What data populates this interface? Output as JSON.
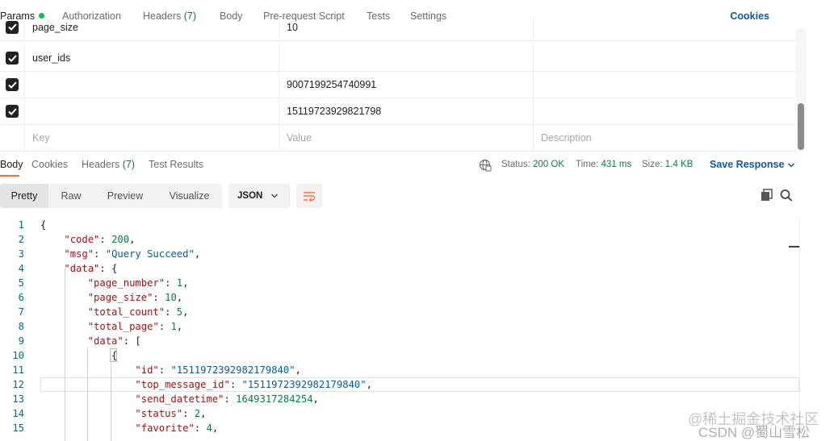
{
  "request_tabs": {
    "params": "Params",
    "authorization": "Authorization",
    "headers_label": "Headers",
    "headers_count": "(7)",
    "body": "Body",
    "pre_request": "Pre-request Script",
    "tests": "Tests",
    "settings": "Settings",
    "cookies": "Cookies"
  },
  "params": {
    "rows": [
      {
        "checked": true,
        "key": "page_size",
        "value": "10",
        "description": ""
      },
      {
        "checked": true,
        "key": "user_ids",
        "value": "",
        "description": ""
      },
      {
        "checked": true,
        "key": "",
        "value": "9007199254740991",
        "description": ""
      },
      {
        "checked": true,
        "key": "",
        "value": "15119723929821798",
        "description": ""
      }
    ],
    "placeholders": {
      "key": "Key",
      "value": "Value",
      "description": "Description"
    }
  },
  "response_tabs": {
    "body": "Body",
    "cookies": "Cookies",
    "headers_label": "Headers",
    "headers_count": "(7)",
    "test_results": "Test Results"
  },
  "status": {
    "status_label": "Status:",
    "status_value": "200 OK",
    "time_label": "Time:",
    "time_value": "431 ms",
    "size_label": "Size:",
    "size_value": "1.4 KB",
    "save_response": "Save Response"
  },
  "view_modes": {
    "pretty": "Pretty",
    "raw": "Raw",
    "preview": "Preview",
    "visualize": "Visualize",
    "format": "JSON",
    "active": "Pretty"
  },
  "code_lines": [
    {
      "n": "1",
      "segs": [
        [
          "p",
          "{"
        ]
      ]
    },
    {
      "n": "2",
      "segs": [
        [
          "p",
          "    "
        ],
        [
          "k",
          "\"code\""
        ],
        [
          "p",
          ": "
        ],
        [
          "n",
          "200"
        ],
        [
          "p",
          ","
        ]
      ]
    },
    {
      "n": "3",
      "segs": [
        [
          "p",
          "    "
        ],
        [
          "k",
          "\"msg\""
        ],
        [
          "p",
          ": "
        ],
        [
          "s",
          "\"Query Succeed\""
        ],
        [
          "p",
          ","
        ]
      ]
    },
    {
      "n": "4",
      "segs": [
        [
          "p",
          "    "
        ],
        [
          "k",
          "\"data\""
        ],
        [
          "p",
          ": {"
        ]
      ]
    },
    {
      "n": "5",
      "segs": [
        [
          "p",
          "        "
        ],
        [
          "k",
          "\"page_number\""
        ],
        [
          "p",
          ": "
        ],
        [
          "n",
          "1"
        ],
        [
          "p",
          ","
        ]
      ]
    },
    {
      "n": "6",
      "segs": [
        [
          "p",
          "        "
        ],
        [
          "k",
          "\"page_size\""
        ],
        [
          "p",
          ": "
        ],
        [
          "n",
          "10"
        ],
        [
          "p",
          ","
        ]
      ]
    },
    {
      "n": "7",
      "segs": [
        [
          "p",
          "        "
        ],
        [
          "k",
          "\"total_count\""
        ],
        [
          "p",
          ": "
        ],
        [
          "n",
          "5"
        ],
        [
          "p",
          ","
        ]
      ]
    },
    {
      "n": "8",
      "segs": [
        [
          "p",
          "        "
        ],
        [
          "k",
          "\"total_page\""
        ],
        [
          "p",
          ": "
        ],
        [
          "n",
          "1"
        ],
        [
          "p",
          ","
        ]
      ]
    },
    {
      "n": "9",
      "segs": [
        [
          "p",
          "        "
        ],
        [
          "k",
          "\"data\""
        ],
        [
          "p",
          ": ["
        ]
      ]
    },
    {
      "n": "10",
      "segs": [
        [
          "p",
          "            {"
        ]
      ]
    },
    {
      "n": "11",
      "segs": [
        [
          "p",
          "                "
        ],
        [
          "k",
          "\"id\""
        ],
        [
          "p",
          ": "
        ],
        [
          "s",
          "\"1511972392982179840\""
        ],
        [
          "p",
          ","
        ]
      ]
    },
    {
      "n": "12",
      "segs": [
        [
          "p",
          "                "
        ],
        [
          "k",
          "\"top_message_id\""
        ],
        [
          "p",
          ": "
        ],
        [
          "s",
          "\"1511972392982179840\""
        ],
        [
          "p",
          ","
        ]
      ]
    },
    {
      "n": "13",
      "segs": [
        [
          "p",
          "                "
        ],
        [
          "k",
          "\"send_datetime\""
        ],
        [
          "p",
          ": "
        ],
        [
          "n",
          "1649317284254"
        ],
        [
          "p",
          ","
        ]
      ]
    },
    {
      "n": "14",
      "segs": [
        [
          "p",
          "                "
        ],
        [
          "k",
          "\"status\""
        ],
        [
          "p",
          ": "
        ],
        [
          "n",
          "2"
        ],
        [
          "p",
          ","
        ]
      ]
    },
    {
      "n": "15",
      "segs": [
        [
          "p",
          "                "
        ],
        [
          "k",
          "\"favorite\""
        ],
        [
          "p",
          ": "
        ],
        [
          "n",
          "4"
        ],
        [
          "p",
          ","
        ]
      ]
    }
  ],
  "watermark": {
    "line1": "@稀土掘金技术社区",
    "line2": "CSDN @蜀山雪松"
  },
  "icons": {
    "checkbox": "checkmark-icon",
    "globe": "globe-icon",
    "chevron": "chevron-down-icon",
    "wrap": "wrap-lines-icon",
    "copy": "copy-icon",
    "search": "search-icon"
  },
  "colors": {
    "accent": "#ff6c37",
    "link": "#0b5aa7",
    "success": "#0a7d45",
    "json_key": "#a31515",
    "json_string": "#0b5aa7",
    "json_number": "#0a7d45"
  }
}
